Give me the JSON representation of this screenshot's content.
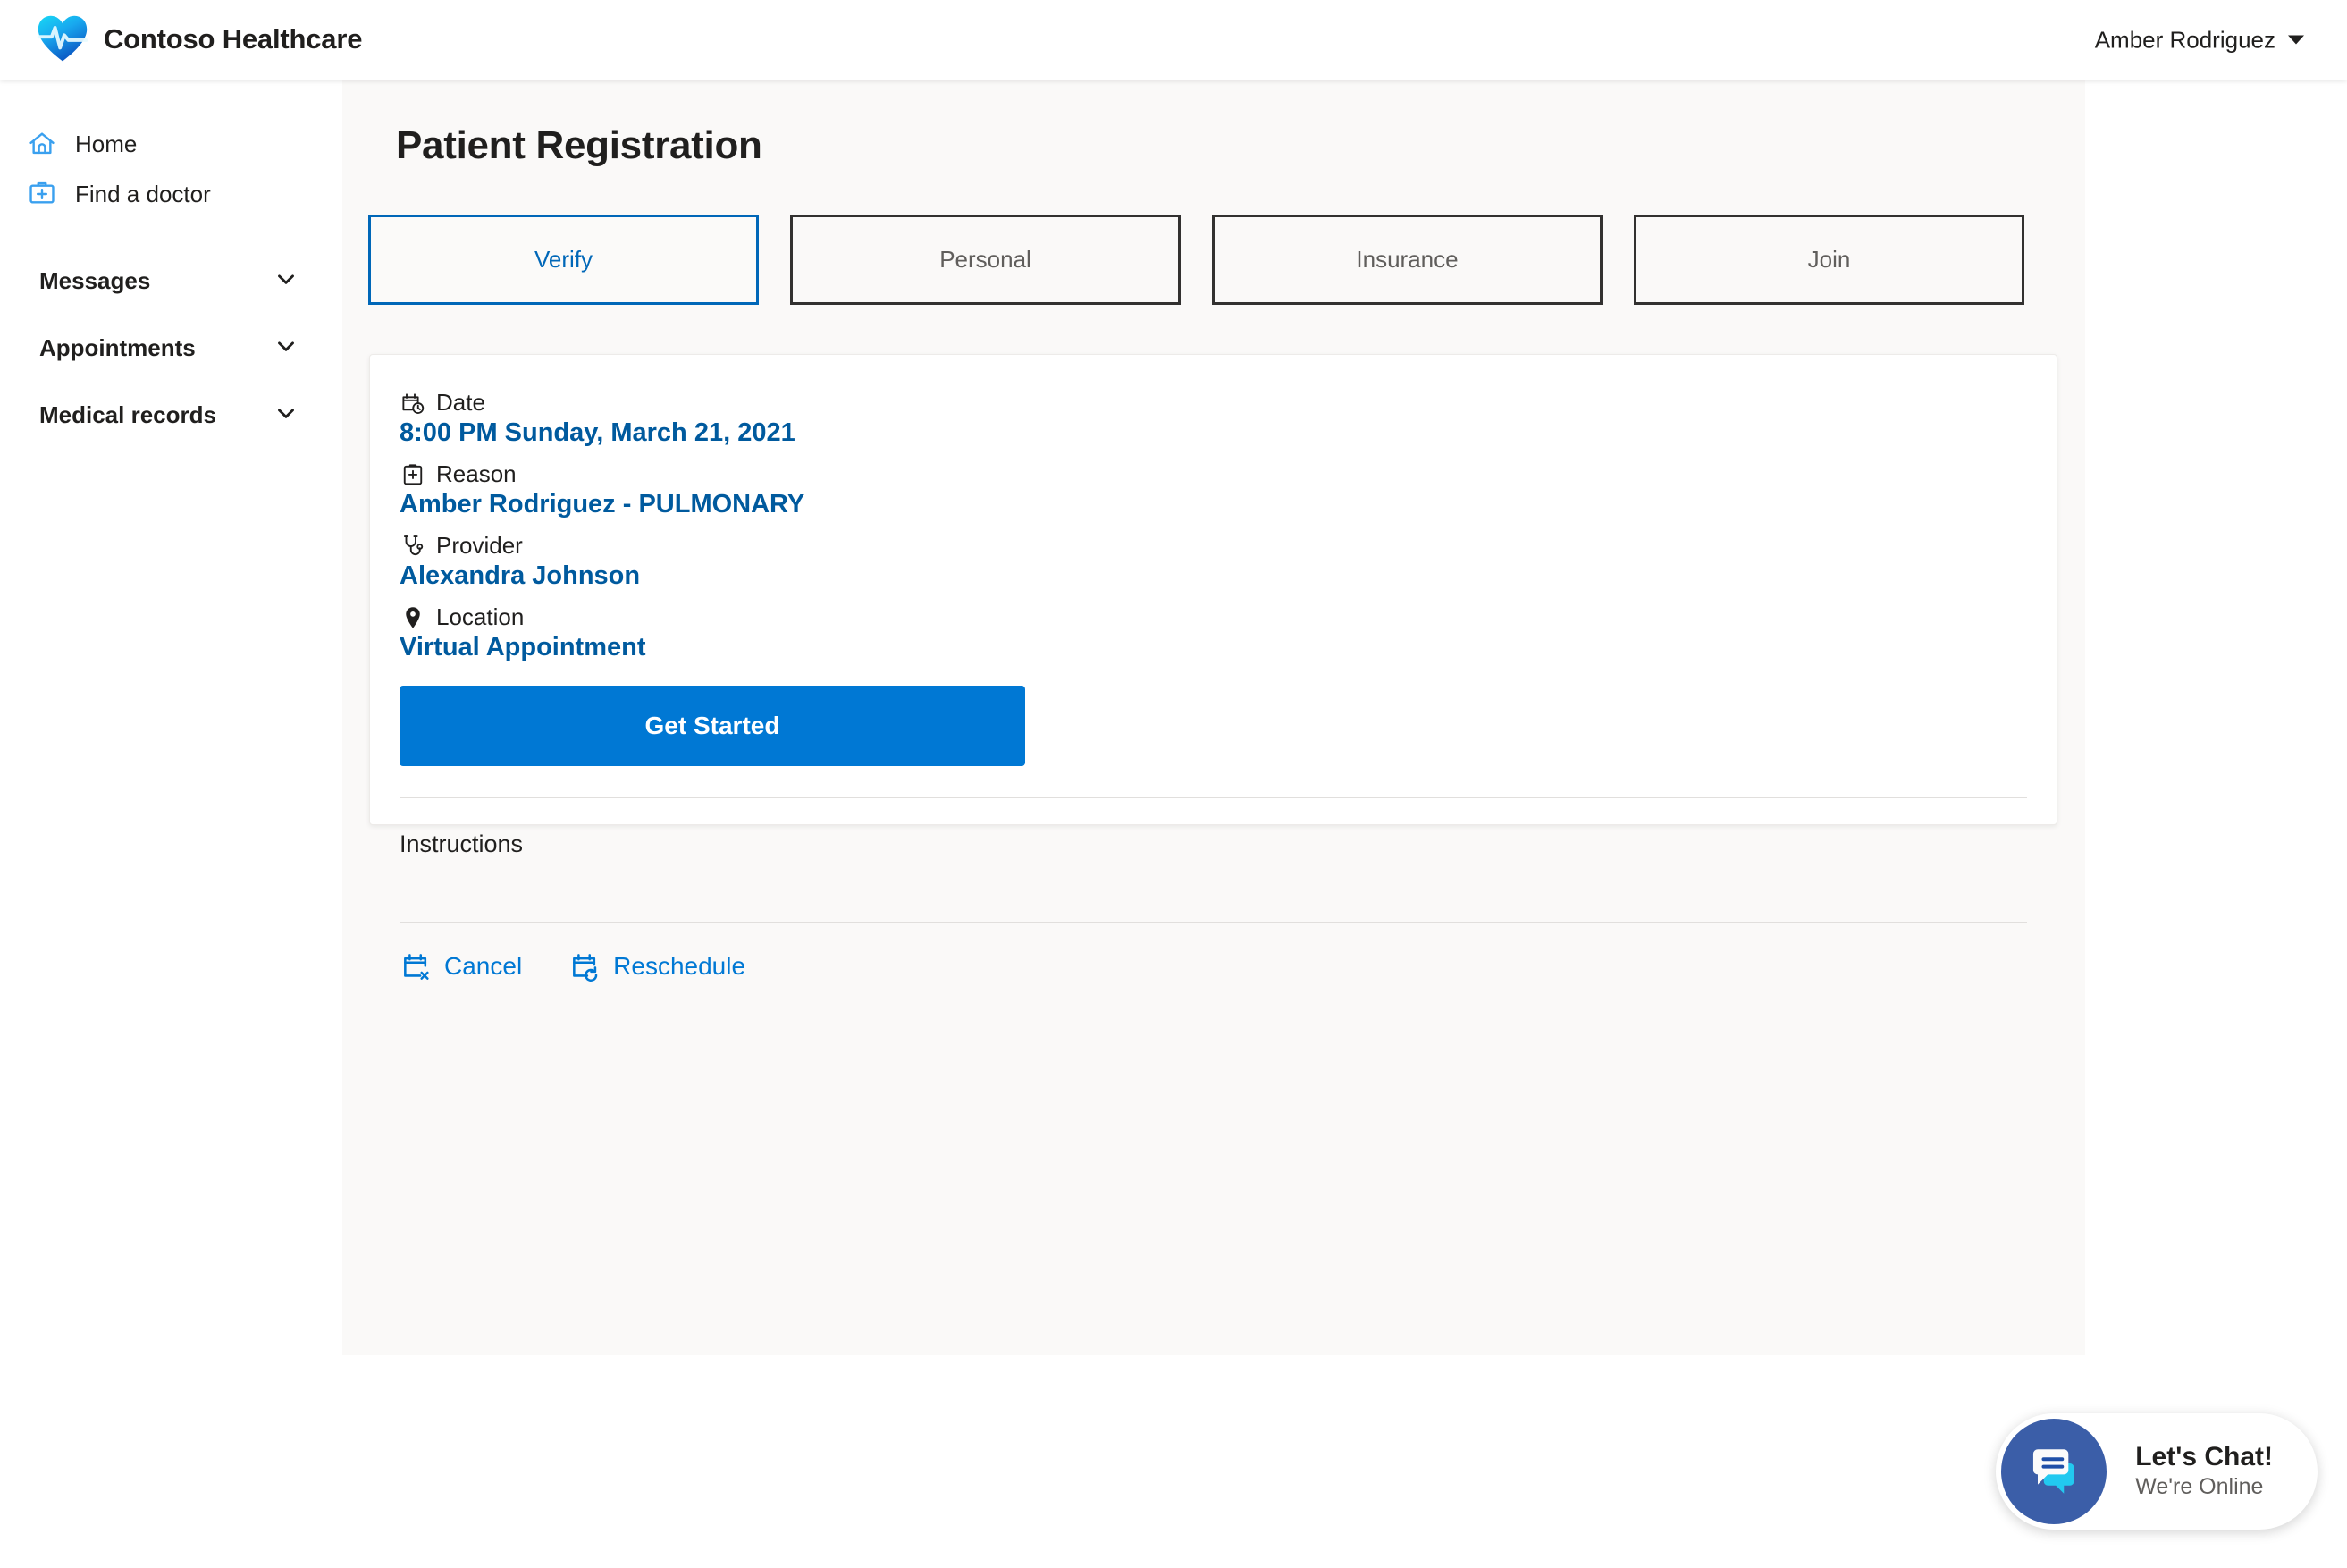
{
  "header": {
    "logo_icon": "heart-pulse-logo",
    "brand_name": "Contoso Healthcare",
    "user_name": "Amber Rodriguez",
    "caret_icon": "chevron-down-icon"
  },
  "sidebar": {
    "links": [
      {
        "label": "Home",
        "icon": "home-icon"
      },
      {
        "label": "Find a doctor",
        "icon": "medical-bag-icon"
      }
    ],
    "groups": [
      {
        "label": "Messages",
        "icon": "chevron-down-icon"
      },
      {
        "label": "Appointments",
        "icon": "chevron-down-icon"
      },
      {
        "label": "Medical records",
        "icon": "chevron-down-icon"
      }
    ]
  },
  "main": {
    "page_title": "Patient Registration",
    "tabs": [
      {
        "label": "Verify",
        "active": true
      },
      {
        "label": "Personal",
        "active": false
      },
      {
        "label": "Insurance",
        "active": false
      },
      {
        "label": "Join",
        "active": false
      }
    ],
    "details": [
      {
        "label": "Date",
        "icon": "calendar-clock-icon",
        "value": "8:00 PM Sunday, March 21, 2021"
      },
      {
        "label": "Reason",
        "icon": "clipboard-plus-icon",
        "value": "Amber Rodriguez - PULMONARY"
      },
      {
        "label": "Provider",
        "icon": "stethoscope-icon",
        "value": "Alexandra Johnson"
      },
      {
        "label": "Location",
        "icon": "map-pin-icon",
        "value": "Virtual Appointment"
      }
    ],
    "cta_label": "Get Started",
    "instructions_title": "Instructions",
    "actions": [
      {
        "label": "Cancel",
        "icon": "calendar-cancel-icon"
      },
      {
        "label": "Reschedule",
        "icon": "calendar-refresh-icon"
      }
    ]
  },
  "chat": {
    "icon": "chat-bubbles-icon",
    "title": "Let's Chat!",
    "subtitle": "We're Online"
  },
  "colors": {
    "accent": "#0078d4",
    "link": "#005a9e",
    "tab_active_border": "#0067b8",
    "tab_border": "#323130",
    "content_bg": "#faf9f8",
    "chat_avatar": "#3b5ea8"
  }
}
